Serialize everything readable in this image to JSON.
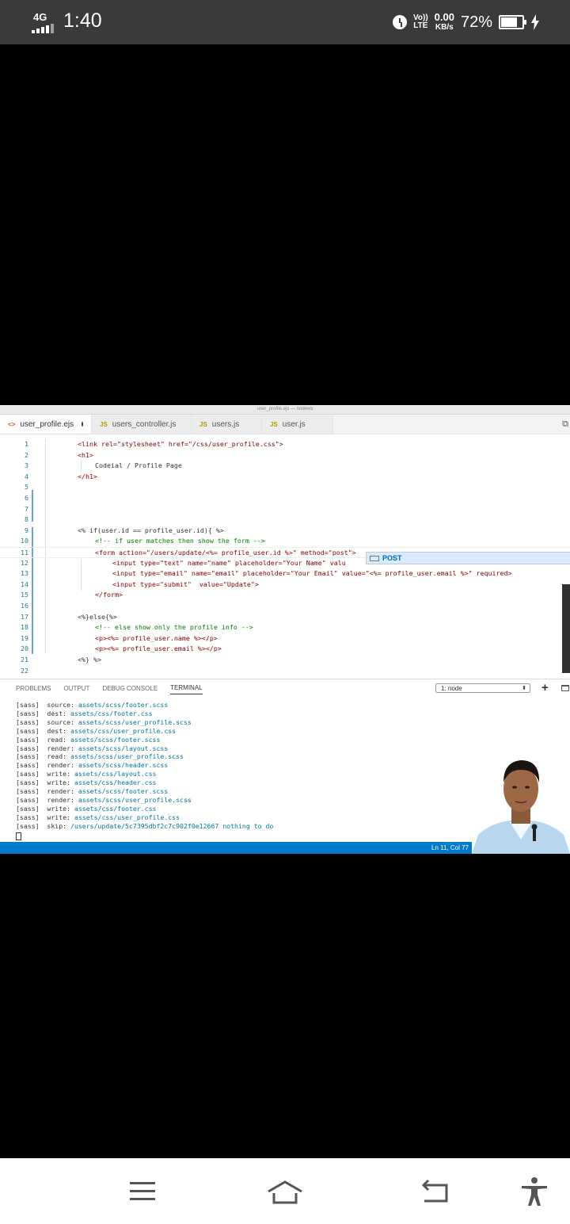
{
  "status_bar": {
    "network_type": "4G",
    "time": "1:40",
    "volte": "Vo)) LTE",
    "speed_value": "0.00",
    "speed_unit": "KB/s",
    "battery_percent": "72%",
    "battery_level": 0.72,
    "icons": [
      "signal-icon",
      "alarm-icon",
      "battery-icon",
      "charging-icon"
    ]
  },
  "window": {
    "title": "user_profile.ejs — nodews"
  },
  "tabs": [
    {
      "label": "user_profile.ejs",
      "icon": "<>",
      "active": true,
      "modified": true
    },
    {
      "label": "users_controller.js",
      "icon": "JS",
      "active": false
    },
    {
      "label": "users.js",
      "icon": "JS",
      "active": false
    },
    {
      "label": "user.js",
      "icon": "JS",
      "active": false
    }
  ],
  "editor": {
    "line_numbers": [
      "1",
      "2",
      "3",
      "4",
      "5",
      "6",
      "7",
      "8",
      "9",
      "10",
      "11",
      "12",
      "13",
      "14",
      "15",
      "16",
      "17",
      "18",
      "19",
      "20",
      "21",
      "22"
    ],
    "lines": [
      "<link rel=\"stylesheet\" href=\"/css/user_profile.css\">",
      "<h1>",
      "Codeial / Profile Page",
      "</h1>",
      "",
      "",
      "",
      "",
      "<% if(user.id == profile_user.id){ %>",
      "<!-- if user matches then show the form -->",
      "<form action=\"/users/update/<%= profile_user.id %>\" method=\"post\">",
      "<input type=\"text\" name=\"name\" placeholder=\"Your Name\" valu",
      "<input type=\"email\" name=\"email\" placeholder=\"Your Email\" value=\"<%= profile_user.email %>\" required>",
      "<input type=\"submit\"  value=\"Update\">",
      "</form>",
      "",
      "<%}else{%>",
      "<!-- else show only the profile info -->",
      "<p><%= profile_user.name %></p>",
      "<p><%= profile_user.email %></p>",
      "<%} %>",
      ""
    ],
    "suggestion": "POST"
  },
  "panel": {
    "tabs": [
      "PROBLEMS",
      "OUTPUT",
      "DEBUG CONSOLE",
      "TERMINAL"
    ],
    "active_tab": "TERMINAL",
    "terminal_select": "1: node",
    "terminal_lines": [
      {
        "prefix": "[sass]  source: ",
        "path": "assets/scss/footer.scss"
      },
      {
        "prefix": "[sass]  dest: ",
        "path": "assets/css/footer.css"
      },
      {
        "prefix": "[sass]  source: ",
        "path": "assets/scss/user_profile.scss"
      },
      {
        "prefix": "[sass]  dest: ",
        "path": "assets/css/user_profile.css"
      },
      {
        "prefix": "[sass]  read: ",
        "path": "assets/scss/footer.scss"
      },
      {
        "prefix": "[sass]  render: ",
        "path": "assets/scss/layout.scss"
      },
      {
        "prefix": "[sass]  read: ",
        "path": "assets/scss/user_profile.scss"
      },
      {
        "prefix": "[sass]  render: ",
        "path": "assets/scss/header.scss"
      },
      {
        "prefix": "[sass]  write: ",
        "path": "assets/css/layout.css"
      },
      {
        "prefix": "[sass]  write: ",
        "path": "assets/css/header.css"
      },
      {
        "prefix": "[sass]  render: ",
        "path": "assets/scss/footer.scss"
      },
      {
        "prefix": "[sass]  render: ",
        "path": "assets/scss/user_profile.scss"
      },
      {
        "prefix": "[sass]  write: ",
        "path": "assets/css/footer.css"
      },
      {
        "prefix": "[sass]  write: ",
        "path": "assets/css/user_profile.css"
      },
      {
        "prefix": "[sass]  skip: ",
        "path": "/users/update/5c7395dbf2c7c902f0e12667 nothing to do"
      }
    ]
  },
  "vscode_status": {
    "cursor_position": "Ln 11, Col 77"
  },
  "nav_bar": {
    "buttons": [
      "menu-icon",
      "home-icon",
      "back-icon",
      "accessibility-icon"
    ]
  },
  "colors": {
    "status_bar_bg": "#3a3a3a",
    "vscode_status_bg": "#007acc",
    "suggest_bg": "#d6ebff"
  }
}
